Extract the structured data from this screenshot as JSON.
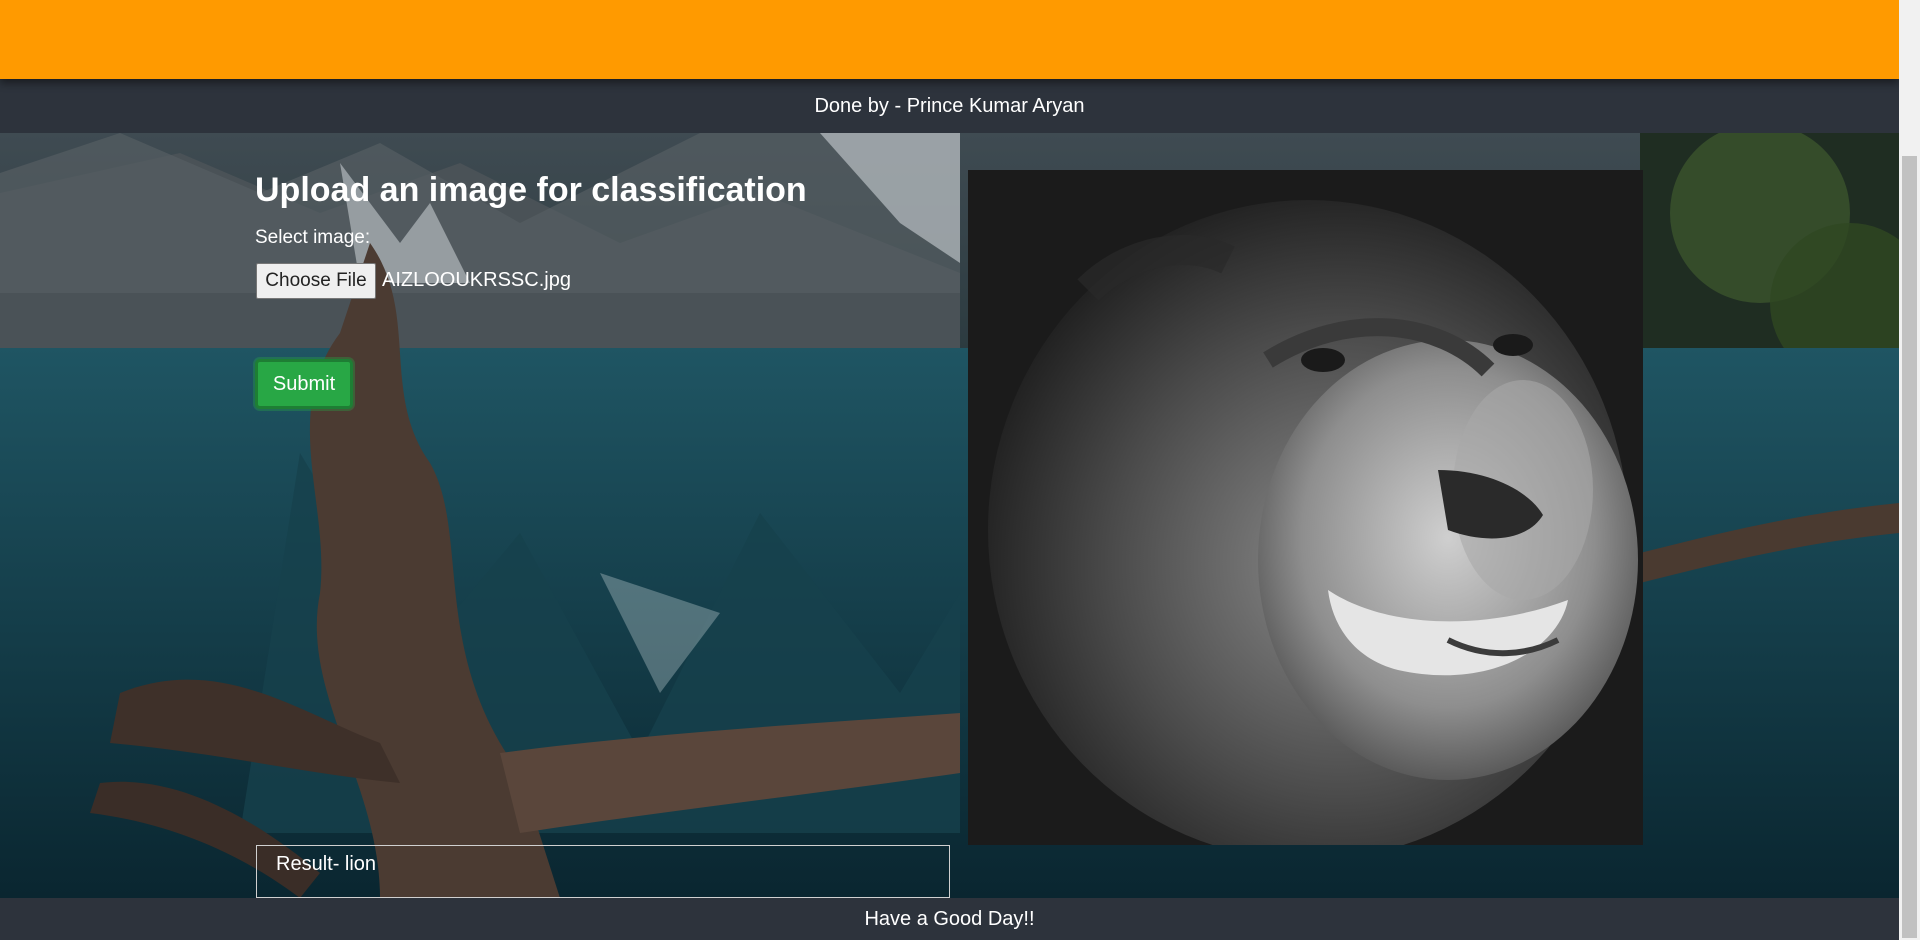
{
  "header": {
    "credit": "Done by - Prince Kumar Aryan"
  },
  "main": {
    "title": "Upload an image for classification",
    "select_label": "Select image:",
    "choose_file_label": "Choose File",
    "file_name": "AIZLOOUKRSSC.jpg",
    "submit_label": "Submit",
    "preview_subject": "lion",
    "result_text": "Result- lion"
  },
  "footer": {
    "text": "Have a Good Day!!"
  },
  "colors": {
    "top_bar": "#ff9a00",
    "header_footer": "#2d333c",
    "submit_button": "#28a745"
  }
}
